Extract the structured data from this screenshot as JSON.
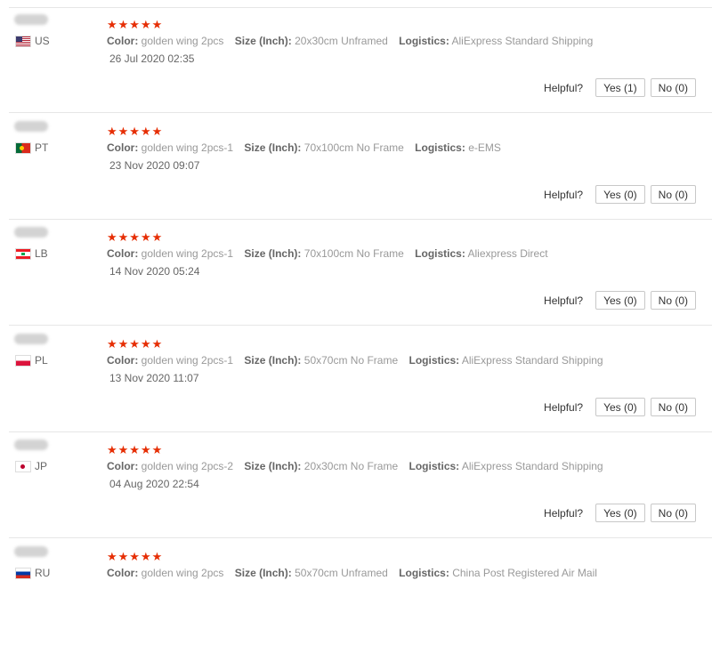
{
  "labels": {
    "color": "Color:",
    "size": "Size (Inch):",
    "logistics": "Logistics:",
    "helpful": "Helpful?"
  },
  "colors": {
    "star": "#e62e04"
  },
  "reviews": [
    {
      "country": "US",
      "flag": "us-flag-icon",
      "stars": "★★★★★",
      "color": "golden wing 2pcs",
      "size": "20x30cm Unframed",
      "logistics": "AliExpress Standard Shipping",
      "date": "26 Jul 2020 02:35",
      "yes": "Yes (1)",
      "no": "No (0)"
    },
    {
      "country": "PT",
      "flag": "pt-flag-icon",
      "stars": "★★★★★",
      "color": "golden wing 2pcs-1",
      "size": "70x100cm No Frame",
      "logistics": "e-EMS",
      "date": "23 Nov 2020 09:07",
      "yes": "Yes (0)",
      "no": "No (0)"
    },
    {
      "country": "LB",
      "flag": "lb-flag-icon",
      "stars": "★★★★★",
      "color": "golden wing 2pcs-1",
      "size": "70x100cm No Frame",
      "logistics": "Aliexpress Direct",
      "date": "14 Nov 2020 05:24",
      "yes": "Yes (0)",
      "no": "No (0)"
    },
    {
      "country": "PL",
      "flag": "pl-flag-icon",
      "stars": "★★★★★",
      "color": "golden wing 2pcs-1",
      "size": "50x70cm No Frame",
      "logistics": "AliExpress Standard Shipping",
      "date": "13 Nov 2020 11:07",
      "yes": "Yes (0)",
      "no": "No (0)"
    },
    {
      "country": "JP",
      "flag": "jp-flag-icon",
      "stars": "★★★★★",
      "color": "golden wing 2pcs-2",
      "size": "20x30cm No Frame",
      "logistics": "AliExpress Standard Shipping",
      "date": "04 Aug 2020 22:54",
      "yes": "Yes (0)",
      "no": "No (0)"
    },
    {
      "country": "RU",
      "flag": "ru-flag-icon",
      "stars": "★★★★★",
      "color": "golden wing 2pcs",
      "size": "50x70cm Unframed",
      "logistics": "China Post Registered Air Mail",
      "date": "",
      "yes": "",
      "no": ""
    }
  ]
}
